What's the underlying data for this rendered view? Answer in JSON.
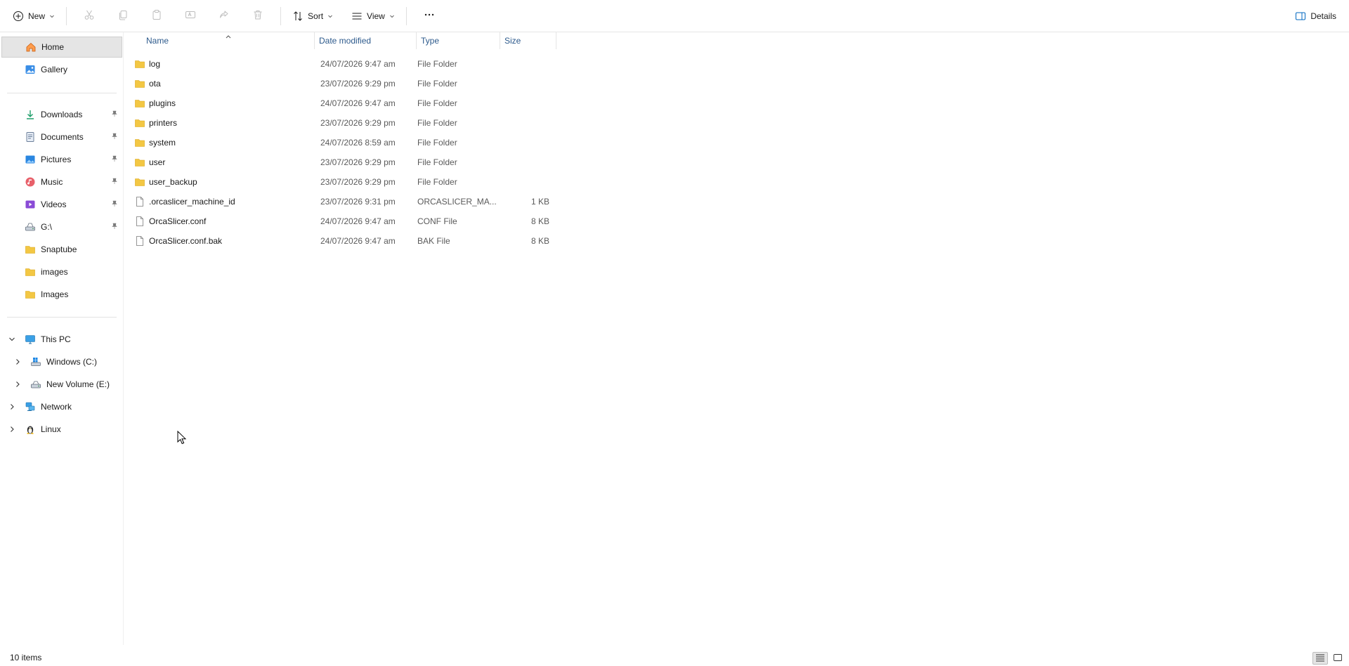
{
  "toolbar": {
    "new_label": "New",
    "sort_label": "Sort",
    "view_label": "View",
    "details_label": "Details",
    "icons": [
      "cut-icon",
      "copy-icon",
      "paste-icon",
      "rename-icon",
      "share-icon",
      "delete-icon"
    ]
  },
  "sidebar": {
    "home": "Home",
    "gallery": "Gallery",
    "quick": [
      {
        "label": "Downloads",
        "icon": "download-icon"
      },
      {
        "label": "Documents",
        "icon": "documents-icon"
      },
      {
        "label": "Pictures",
        "icon": "pictures-icon"
      },
      {
        "label": "Music",
        "icon": "music-icon"
      },
      {
        "label": "Videos",
        "icon": "videos-icon"
      },
      {
        "label": "G:\\",
        "icon": "drive-icon"
      },
      {
        "label": "Snaptube",
        "icon": "folder-icon"
      },
      {
        "label": "images",
        "icon": "folder-icon"
      },
      {
        "label": "Images",
        "icon": "folder-icon"
      }
    ],
    "this_pc": "This PC",
    "drive_c": "Windows (C:)",
    "drive_e": "New Volume (E:)",
    "network": "Network",
    "linux": "Linux"
  },
  "filelist": {
    "columns": {
      "name": "Name",
      "date": "Date modified",
      "type": "Type",
      "size": "Size"
    },
    "rows": [
      {
        "name": "log",
        "date": "24/07/2026 9:47 am",
        "type": "File Folder",
        "size": "",
        "kind": "folder"
      },
      {
        "name": "ota",
        "date": "23/07/2026 9:29 pm",
        "type": "File Folder",
        "size": "",
        "kind": "folder"
      },
      {
        "name": "plugins",
        "date": "24/07/2026 9:47 am",
        "type": "File Folder",
        "size": "",
        "kind": "folder"
      },
      {
        "name": "printers",
        "date": "23/07/2026 9:29 pm",
        "type": "File Folder",
        "size": "",
        "kind": "folder"
      },
      {
        "name": "system",
        "date": "24/07/2026 8:59 am",
        "type": "File Folder",
        "size": "",
        "kind": "folder"
      },
      {
        "name": "user",
        "date": "23/07/2026 9:29 pm",
        "type": "File Folder",
        "size": "",
        "kind": "folder"
      },
      {
        "name": "user_backup",
        "date": "23/07/2026 9:29 pm",
        "type": "File Folder",
        "size": "",
        "kind": "folder"
      },
      {
        "name": ".orcaslicer_machine_id",
        "date": "23/07/2026 9:31 pm",
        "type": "ORCASLICER_MA...",
        "size": "1 KB",
        "kind": "file"
      },
      {
        "name": "OrcaSlicer.conf",
        "date": "24/07/2026 9:47 am",
        "type": "CONF File",
        "size": "8 KB",
        "kind": "file"
      },
      {
        "name": "OrcaSlicer.conf.bak",
        "date": "24/07/2026 9:47 am",
        "type": "BAK File",
        "size": "8 KB",
        "kind": "file"
      }
    ]
  },
  "status": {
    "item_count": "10 items"
  },
  "colors": {
    "folder": "#f3c743",
    "accent": "#0067c0",
    "selected": "#e5e5e5",
    "header_text": "#2d5a8c"
  }
}
